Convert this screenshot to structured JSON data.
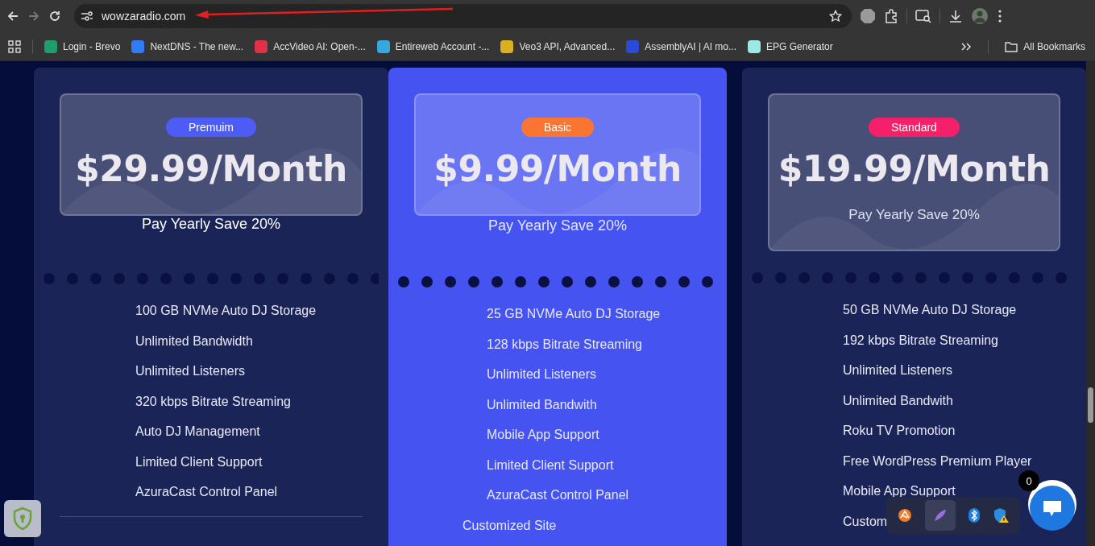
{
  "browser": {
    "url": "wowzaradio.com",
    "bookmarks": [
      {
        "label": "Login - Brevo",
        "color": "#1f9d6b"
      },
      {
        "label": "NextDNS - The new...",
        "color": "#2f7cf6"
      },
      {
        "label": "AccVideo AI: Open-...",
        "color": "#e0304a"
      },
      {
        "label": "Entireweb Account -...",
        "color": "#35a8e0"
      },
      {
        "label": "Veo3 API, Advanced...",
        "color": "#d8b020"
      },
      {
        "label": "AssemblyAI | AI mo...",
        "color": "#2a4bd7"
      },
      {
        "label": "EPG Generator",
        "color": "#9be8e4"
      }
    ],
    "all_bookmarks": "All Bookmarks"
  },
  "plans": [
    {
      "badge": {
        "label": "Premuim",
        "color": "#4d5cf5"
      },
      "price": "$29.99/Month",
      "note": "Pay Yearly Save 20%",
      "note_in_box": false,
      "highlighted": false,
      "features": [
        "100 GB NVMe Auto DJ Storage",
        "Unlimited Bandwidth",
        "Unlimited Listeners",
        "320 kbps Bitrate Streaming",
        "Auto DJ Management",
        "Limited Client Support",
        "AzuraCast Control Panel"
      ]
    },
    {
      "badge": {
        "label": "Basic",
        "color": "#f97531"
      },
      "price": "$9.99/Month",
      "note": "Pay Yearly Save 20%",
      "note_in_box": false,
      "highlighted": true,
      "features": [
        "25 GB NVMe Auto DJ Storage",
        "128 kbps Bitrate Streaming",
        "Unlimited Listeners",
        "Unlimited Bandwith",
        "Mobile App Support",
        "Limited Client Support",
        "AzuraCast Control Panel"
      ],
      "extra_feature": "Customized Site"
    },
    {
      "badge": {
        "label": "Standard",
        "color": "#f5206a"
      },
      "price": "$19.99/Month",
      "note": "Pay Yearly Save 20%",
      "note_in_box": true,
      "highlighted": false,
      "features": [
        "50 GB NVMe Auto DJ Storage",
        "192 kbps Bitrate Streaming",
        "Unlimited Listeners",
        "Unlimited Bandwith",
        "Roku TV Promotion",
        "Free WordPress Premium Player",
        "Mobile App Support",
        "Custom"
      ]
    }
  ],
  "chat": {
    "count": "0"
  }
}
